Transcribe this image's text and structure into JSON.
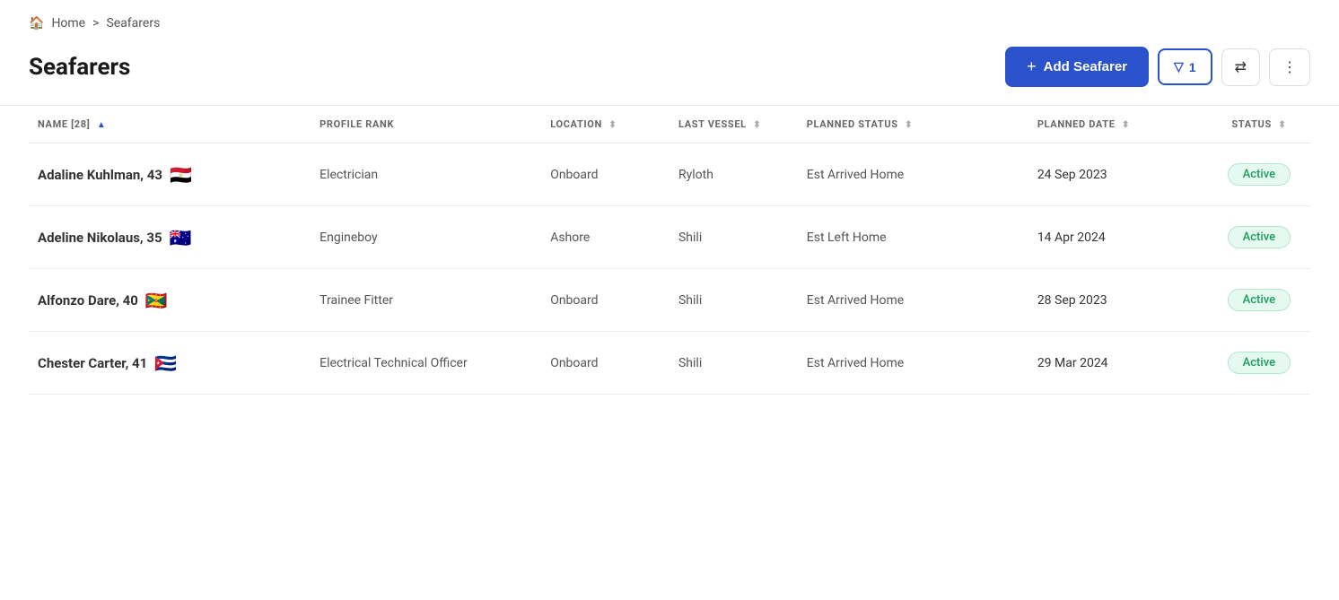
{
  "breadcrumb": {
    "home_label": "Home",
    "separator": ">",
    "current": "Seafarers"
  },
  "page": {
    "title": "Seafarers"
  },
  "toolbar": {
    "add_button_label": "Add Seafarer",
    "filter_label": "1",
    "filter_icon": "▽",
    "swap_icon": "⇄",
    "more_icon": "⋮"
  },
  "table": {
    "columns": [
      {
        "key": "name",
        "label": "NAME [28]",
        "sortable": true,
        "active": true
      },
      {
        "key": "profile_rank",
        "label": "PROFILE RANK",
        "sortable": false
      },
      {
        "key": "location",
        "label": "LOCATION",
        "sortable": true
      },
      {
        "key": "last_vessel",
        "label": "LAST VESSEL",
        "sortable": true
      },
      {
        "key": "planned_status",
        "label": "PLANNED STATUS",
        "sortable": true
      },
      {
        "key": "planned_date",
        "label": "PLANNED DATE",
        "sortable": true
      },
      {
        "key": "status",
        "label": "STATUS",
        "sortable": true
      }
    ],
    "rows": [
      {
        "name": "Adaline Kuhlman, 43",
        "flag": "🇪🇬",
        "profile_rank": "Electrician",
        "location": "Onboard",
        "last_vessel": "Ryloth",
        "planned_status": "Est Arrived Home",
        "planned_date": "24 Sep 2023",
        "status": "Active"
      },
      {
        "name": "Adeline Nikolaus, 35",
        "flag": "🇦🇺",
        "profile_rank": "Engineboy",
        "location": "Ashore",
        "last_vessel": "Shili",
        "planned_status": "Est Left Home",
        "planned_date": "14 Apr 2024",
        "status": "Active"
      },
      {
        "name": "Alfonzo Dare, 40",
        "flag": "🇬🇩",
        "profile_rank": "Trainee Fitter",
        "location": "Onboard",
        "last_vessel": "Shili",
        "planned_status": "Est Arrived Home",
        "planned_date": "28 Sep 2023",
        "status": "Active"
      },
      {
        "name": "Chester Carter, 41",
        "flag": "🇨🇺",
        "profile_rank": "Electrical Technical Officer",
        "location": "Onboard",
        "last_vessel": "Shili",
        "planned_status": "Est Arrived Home",
        "planned_date": "29 Mar 2024",
        "status": "Active"
      }
    ]
  }
}
